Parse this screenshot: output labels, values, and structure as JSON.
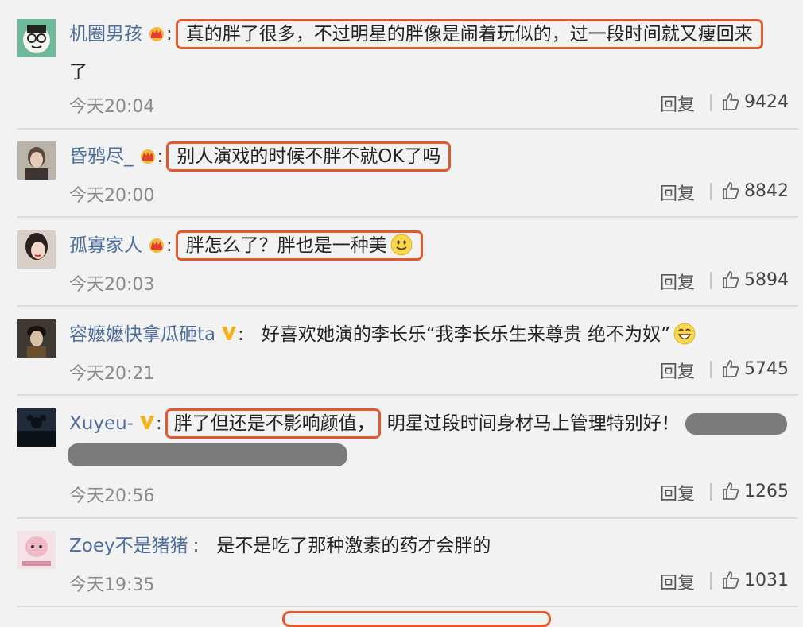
{
  "comments": [
    {
      "username": "机圈男孩",
      "badge": "crown-icon",
      "text": "真的胖了很多，不过明星的胖像是闹着玩似的，过一段时间就又瘦回来",
      "continuation": "了",
      "time": "今天20:04",
      "reply": "回复",
      "likes": "9424",
      "highlighted": true
    },
    {
      "username": "昏鸦尽_",
      "badge": "crown-icon",
      "text": "别人演戏的时候不胖不就OK了吗",
      "time": "今天20:00",
      "reply": "回复",
      "likes": "8842",
      "highlighted": true
    },
    {
      "username": "孤寡家人",
      "badge": "crown-icon",
      "text": "胖怎么了？胖也是一种美",
      "emoji": "smile-emoji-icon",
      "time": "今天20:03",
      "reply": "回复",
      "likes": "5894",
      "highlighted": true
    },
    {
      "username": "容嬷嬷快拿瓜砸ta",
      "badge": "verified-v-icon",
      "text": "好喜欢她演的李长乐“我李长乐生来尊贵 绝不为奴”",
      "emoji": "grin-emoji-icon",
      "time": "今天20:21",
      "reply": "回复",
      "likes": "5745",
      "highlighted": false
    },
    {
      "username": "Xuyeu-",
      "badge": "verified-v-icon",
      "text_highlight": "胖了但还是不影响颜值，",
      "text_rest": "明星过段时间身材马上管理特别好！",
      "time": "今天20:56",
      "reply": "回复",
      "likes": "1265",
      "highlighted": true
    },
    {
      "username": "Zoey不是猪猪",
      "text": "是不是吃了那种激素的药才会胖的",
      "time": "今天19:35",
      "reply": "回复",
      "likes": "1031",
      "highlighted": false
    }
  ]
}
